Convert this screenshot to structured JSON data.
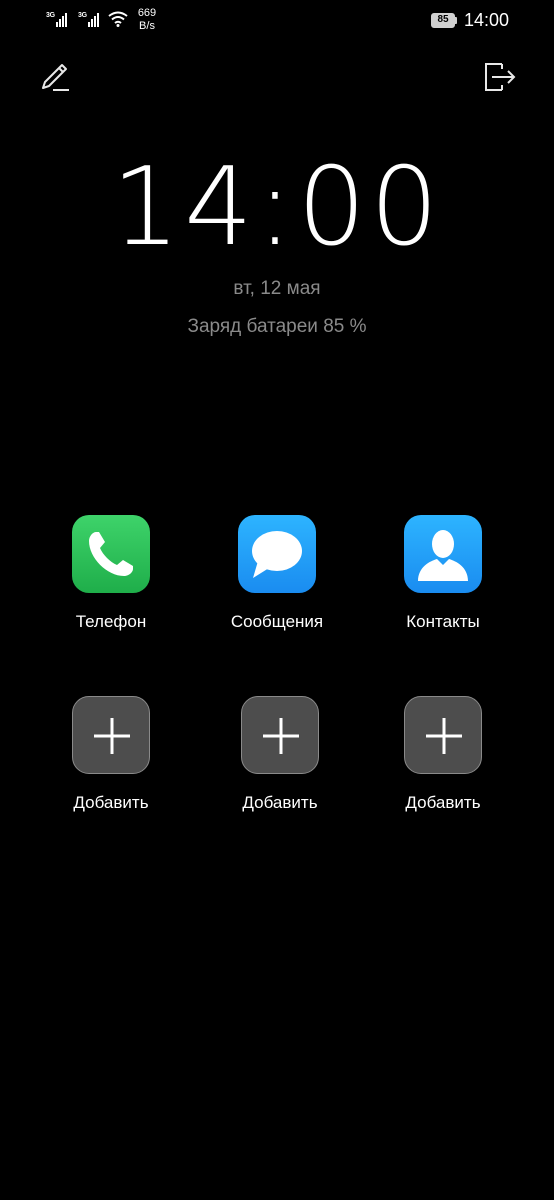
{
  "status_bar": {
    "signal1_label": "3G",
    "signal2_label": "3G",
    "net_speed_value": "669",
    "net_speed_unit": "B/s",
    "battery_level": "85",
    "time": "14:00"
  },
  "lockscreen": {
    "clock": "14:00",
    "date": "вт, 12 мая",
    "battery_status": "Заряд батареи 85 %"
  },
  "apps": [
    {
      "label": "Телефон",
      "icon": "phone-icon",
      "color": "#2bc45a"
    },
    {
      "label": "Сообщения",
      "icon": "message-bubble-icon",
      "color": "#21a0f8"
    },
    {
      "label": "Контакты",
      "icon": "contact-person-icon",
      "color": "#21a0f8"
    }
  ],
  "add_slots": [
    {
      "label": "Добавить",
      "icon": "plus-icon"
    },
    {
      "label": "Добавить",
      "icon": "plus-icon"
    },
    {
      "label": "Добавить",
      "icon": "plus-icon"
    }
  ],
  "toolbar": {
    "edit_icon": "pencil-icon",
    "exit_icon": "exit-icon"
  }
}
